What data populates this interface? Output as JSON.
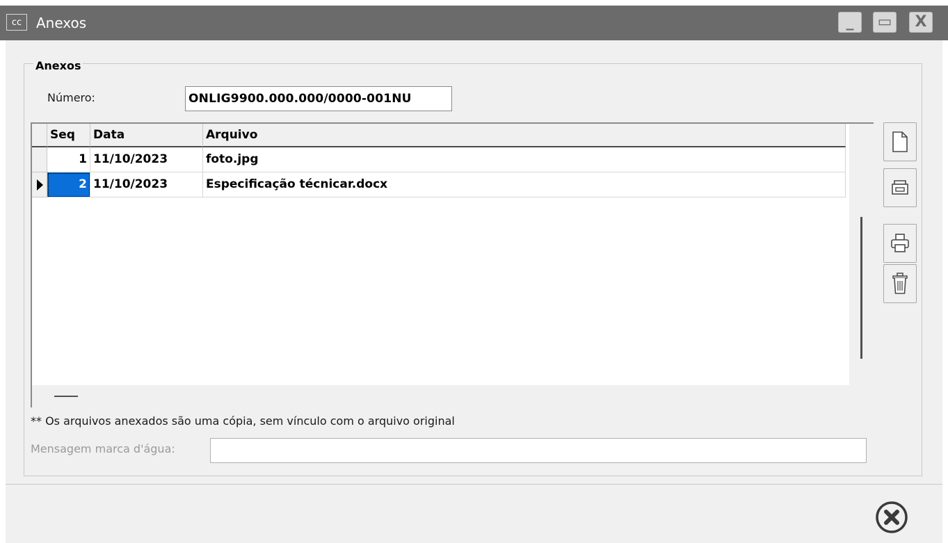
{
  "window": {
    "icon_text": "cc",
    "title": "Anexos",
    "controls": {
      "minimize": "_",
      "maximize": "▭",
      "close": "X"
    }
  },
  "group": {
    "title": "Anexos"
  },
  "numero": {
    "label": "Número:",
    "value": "ONLIG9900.000.000/0000-001NU"
  },
  "grid": {
    "columns": [
      "Seq",
      "Data",
      "Arquivo"
    ],
    "rows": [
      {
        "seq": "1",
        "data": "11/10/2023",
        "arquivo": "foto.jpg",
        "current": false
      },
      {
        "seq": "2",
        "data": "11/10/2023",
        "arquivo": "Especificação técnicar.docx",
        "current": true
      }
    ]
  },
  "toolbar": {
    "icons": [
      "new-document-icon",
      "scanner-icon",
      "print-icon",
      "trash-icon"
    ]
  },
  "footnote": "** Os arquivos anexados são uma cópia, sem vínculo com o arquivo original",
  "watermark": {
    "label": "Mensagem marca d'água:",
    "value": ""
  },
  "footer": {
    "close_icon": "close-circle-icon"
  }
}
